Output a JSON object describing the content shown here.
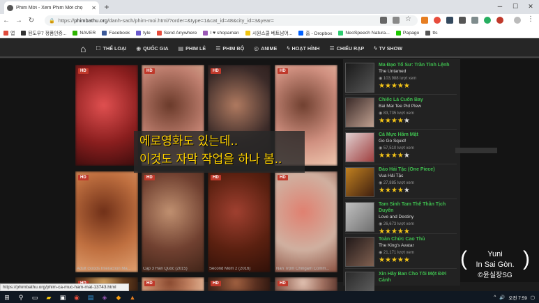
{
  "browser": {
    "tab_title": "Phim Mới - Xem Phim Mới chọ",
    "url_prefix": "https://",
    "url_domain": "phimbathu.org",
    "url_path": "/danh-sach/phim-moi.html/?order=&type=1&cat_id=48&city_id=3&year=",
    "status_url": "https://phimbathu.org/phim-ca-muc-ham-mat-13743.html"
  },
  "bookmarks": [
    {
      "label": "앱",
      "color": "#e04b3c"
    },
    {
      "label": "된도우7 정품인증...",
      "color": "#333333"
    },
    {
      "label": "NAVER",
      "color": "#2db400"
    },
    {
      "label": "Facebook",
      "color": "#3b5998"
    },
    {
      "label": "tyle",
      "color": "#6a5acd"
    },
    {
      "label": "Send Anywhere",
      "color": "#e74c3c"
    },
    {
      "label": "I ♥ shopaman",
      "color": "#9b59b6"
    },
    {
      "label": "시원스쿨 베트남어...",
      "color": "#f1c40f"
    },
    {
      "label": "홈 - Dropbox",
      "color": "#0061ff"
    },
    {
      "label": "NeoSpeech Natura...",
      "color": "#2ecc71"
    },
    {
      "label": "Papago",
      "color": "#1ec800"
    },
    {
      "label": "tts",
      "color": "#555555"
    }
  ],
  "nav": {
    "items": [
      {
        "label": "THỂ LOẠI",
        "icon": "☐"
      },
      {
        "label": "QUỐC GIA",
        "icon": "◉"
      },
      {
        "label": "PHIM LẺ",
        "icon": "▤"
      },
      {
        "label": "PHIM BỘ",
        "icon": "☰"
      },
      {
        "label": "ANIME",
        "icon": "◎"
      },
      {
        "label": "HOẠT HÌNH",
        "icon": "ϟ"
      },
      {
        "label": "CHIẾU RẠP",
        "icon": "☰"
      },
      {
        "label": "TV SHOW",
        "icon": "ϟ"
      }
    ]
  },
  "grid": {
    "badge": "HD",
    "row2_titles": [
      "Adult Goods Interaction Ma...",
      "Cặp 3 Hàn Quốc (2015)",
      "Second Mom 2 (2016)",
      "Nàn Trộm Chingam Comm..."
    ]
  },
  "caption": {
    "line1": "에로영화도 있는데..",
    "line2": "이것도 자막 작업을 하나 봄.."
  },
  "sidebar": {
    "views_suffix": "lượt xem",
    "items": [
      {
        "vi_title": "Ma Đạo Tổ Sư: Trần Tình Lệnh",
        "en_title": "The Untamed",
        "views": "103,988",
        "rating": 5
      },
      {
        "vi_title": "Chiếc Lá Cuốn Bay",
        "en_title": "Bai Mai Tee Pid Plew",
        "views": "83,735",
        "rating": 4
      },
      {
        "vi_title": "Cá Mực Hầm Mật",
        "en_title": "Go Go Squid!",
        "views": "57,510",
        "rating": 4
      },
      {
        "vi_title": "Đảo Hải Tặc (One Piece)",
        "en_title": "Vua Hải Tặc",
        "views": "27,885",
        "rating": 4
      },
      {
        "vi_title": "Tam Sinh Tam Thế Thần Tịch Duyên",
        "en_title": "Love and Destiny",
        "views": "26,673",
        "rating": 5
      },
      {
        "vi_title": "Toàn Chức Cao Thủ",
        "en_title": "The King's Avatar",
        "views": "21,171",
        "rating": 5
      },
      {
        "vi_title": "Xin Hãy Ban Cho Tôi Một Đời Cảnh",
        "en_title": "",
        "views": "",
        "rating": 0
      }
    ]
  },
  "watermark": {
    "line1": "Yuni",
    "line2": "In Sai Gòn.",
    "line3": "©윤실장SG"
  },
  "taskbar": {
    "time": "오전 7:59"
  }
}
